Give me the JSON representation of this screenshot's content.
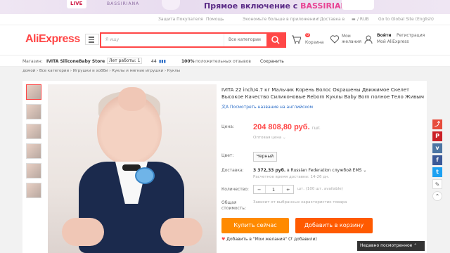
{
  "banner": {
    "live_label": "LIVE",
    "brand_small": "BASSIRIANA",
    "promo_prefix": "Прямое включение с ",
    "promo_brand": "BASSIRIANA"
  },
  "topbar": {
    "buyer_protection": "Защита Покупателя",
    "help": "Помощь",
    "app": "Экономьте больше в приложении!",
    "ship_to": "Доставка в",
    "currency": "/ RUB",
    "global": "Go to Global Site (English)"
  },
  "header": {
    "logo": "AliExpress",
    "search_placeholder": "Я ищу",
    "search_category": "Все категории",
    "cart_count": "0",
    "cart_label": "Корзина",
    "wish_line1": "Мои",
    "wish_line2": "желания",
    "login": "Войти",
    "register": "Регистрация",
    "my_account": "Мой AliExpress"
  },
  "store": {
    "label": "Магазин:",
    "name": "IVITA SiliconeBaby Store",
    "years": "Лет работы: 1",
    "rating": "44",
    "feedback_pct": "100%",
    "feedback_label": "положительных отзывов",
    "save": "Сохранить"
  },
  "breadcrumbs": "домой › Все категории › Игрушки и хобби › Куклы и мягкие игрушки › Куклы",
  "product": {
    "title": "IVITA 22 inch/4.7 кг Мальчик Корень Волос Окрашены Движимое Скелет Высокое Качество Силиконовые Reborn Куклы Baby Born полноe Тело Живым",
    "translate": "Посмотреть название на английском",
    "price_label": "Цена:",
    "price": "204 808,80 руб.",
    "price_unit": "/ шт.",
    "wholesale": "Оптовая цена",
    "color_label": "Цвет:",
    "color_value": "Черный",
    "ship_label": "Доставка:",
    "ship_price": "3 372,33 руб.",
    "ship_to": "в Russian Federation службой EMS",
    "ship_time": "Расчетное время доставки: 14-26 дн.",
    "qty_label": "Количество:",
    "qty_minus": "−",
    "qty_value": "1",
    "qty_plus": "+",
    "qty_avail": "шт. (100 шт. available)",
    "total_label1": "Общая",
    "total_label2": "стоимость:",
    "total_value": "Зависит от выбранных характеристик товара",
    "buy_now": "Купить сейчас",
    "add_cart": "Добавить в корзину",
    "wishlist": "Добавить в \"Мои желания\" (7 добавили)"
  },
  "recent": "Недавно посмотренное",
  "colors": {
    "brand": "#ff4747",
    "buy": "#ff8a00",
    "cart": "#ff5a00"
  }
}
